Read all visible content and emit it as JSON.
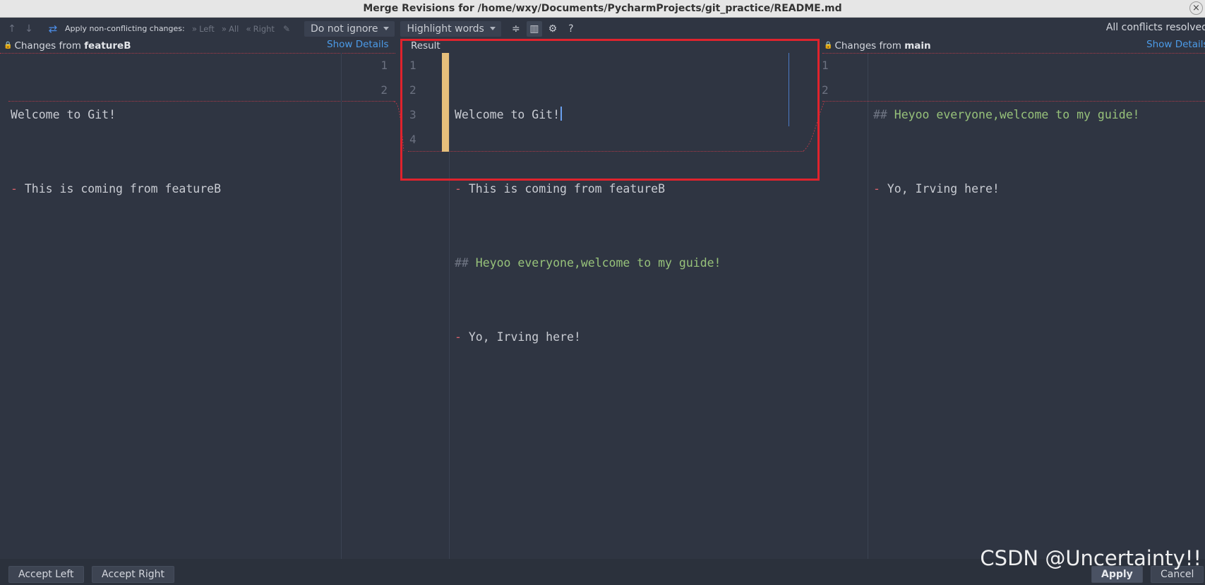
{
  "window": {
    "title": "Merge Revisions for /home/wxy/Documents/PycharmProjects/git_practice/README.md",
    "close_glyph": "×"
  },
  "toolbar": {
    "apply_non_conflicting": "Apply non-conflicting changes:",
    "left": "Left",
    "all": "All",
    "right": "Right",
    "ignore_dropdown": "Do not ignore",
    "highlight_dropdown": "Highlight words",
    "help": "?",
    "status": "All conflicts resolved"
  },
  "left_panel": {
    "header_prefix": "Changes from",
    "branch": "featureB",
    "show_details": "Show Details",
    "lines": [
      {
        "number": "1",
        "prefix": "",
        "text": "Welcome to Git!"
      },
      {
        "number": "2",
        "prefix": "-",
        "text": " This is coming from featureB"
      }
    ]
  },
  "result_panel": {
    "header": "Result",
    "lines": [
      {
        "number": "1",
        "prefix": "",
        "text": "Welcome to Git!"
      },
      {
        "number": "2",
        "prefix": "-",
        "text": " This is coming from featureB"
      },
      {
        "number": "3",
        "prefix": "##",
        "text": " Heyoo everyone,welcome to my guide!"
      },
      {
        "number": "4",
        "prefix": "-",
        "text": " Yo, Irving here!"
      }
    ]
  },
  "right_panel": {
    "header_prefix": "Changes from",
    "branch": "main",
    "show_details": "Show Details",
    "lines": [
      {
        "number": "1",
        "prefix": "##",
        "text": " Heyoo everyone,welcome to my guide!"
      },
      {
        "number": "2",
        "prefix": "-",
        "text": " Yo, Irving here!"
      }
    ]
  },
  "footer": {
    "accept_left": "Accept Left",
    "accept_right": "Accept Right",
    "apply": "Apply",
    "cancel": "Cancel"
  },
  "watermark": "CSDN @Uncertainty!!",
  "colors": {
    "background": "#2f3542",
    "conflict_marker": "#e6bf7b",
    "heading_green": "#97c27a",
    "dash_red": "#d8616a",
    "annotation_red": "#e0232d",
    "link_blue": "#4c9be8"
  }
}
